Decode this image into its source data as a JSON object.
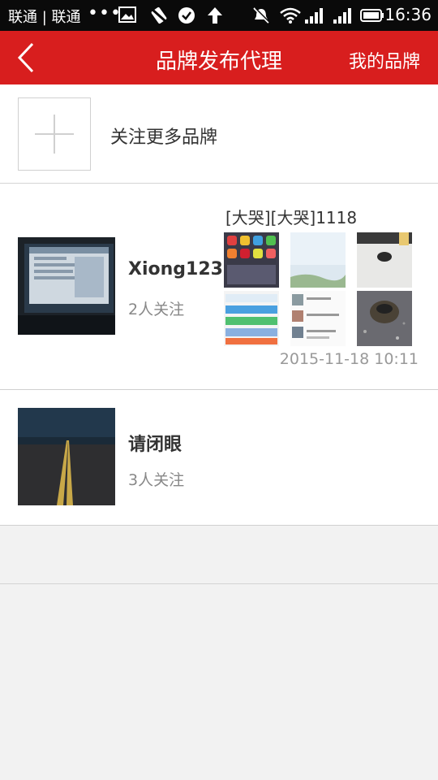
{
  "status_bar": {
    "carrier": "联通 | 联通",
    "dots": "•••",
    "time": "16:36"
  },
  "header": {
    "title": "品牌发布代理",
    "my_brands": "我的品牌"
  },
  "follow_more": {
    "label": "关注更多品牌"
  },
  "brands": [
    {
      "name": "Xiong123",
      "followers": "2人关注",
      "post": {
        "text": "[大哭][大哭]1118",
        "time": "2015-11-18 10:11",
        "photos": [
          "phone-home-screen",
          "sky-landscape",
          "desk-mouse",
          "app-list-screenshot",
          "chat-screenshot",
          "ring-on-gravel"
        ]
      }
    },
    {
      "name": "请闭眼",
      "followers": "3人关注"
    }
  ],
  "colors": {
    "header_red": "#d81e1e",
    "status_bar": "#0a0a0a",
    "background": "#f2f2f2"
  }
}
